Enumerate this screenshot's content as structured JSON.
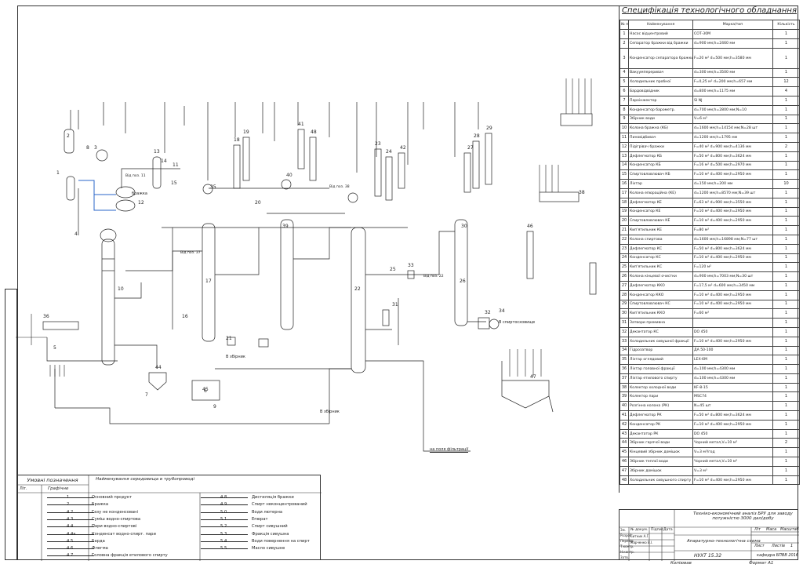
{
  "spec": {
    "title": "Специфікація технологічного обладнання",
    "headers": [
      "№ поз",
      "Найменування",
      "Марка/тип",
      "Кількість"
    ],
    "rows": [
      {
        "n": "1",
        "name": "Насос відцентровий",
        "mark": "СОТ-30М",
        "qty": "1"
      },
      {
        "n": "2",
        "name": "Сепаратор бражки від бражки",
        "mark": "d=900 мм;h=2460 мм",
        "qty": "1"
      },
      {
        "n": "3",
        "name": "Конденсатор сепаратора бражки бражки",
        "mark": "F=20 м² d=500 мм;h=3580 мм",
        "qty": "1"
      },
      {
        "n": "4",
        "name": "Вакуумпереривач",
        "mark": "d=300 мм;h=3500 мм",
        "qty": "1"
      },
      {
        "n": "5",
        "name": "Холодильник пробної",
        "mark": "F=0,25 м² d=200 мм;h=657 мм",
        "qty": "12"
      },
      {
        "n": "6",
        "name": "Бардовідвідник",
        "mark": "d=800 мм;h=1175 мм",
        "qty": "4"
      },
      {
        "n": "7",
        "name": "Пароінжектор",
        "mark": "SI NJ",
        "qty": "1"
      },
      {
        "n": "8",
        "name": "Конденсатор барометр.",
        "mark": "d=700 мм;h=2800 мм;N=10",
        "qty": "1"
      },
      {
        "n": "9",
        "name": "Збірник води",
        "mark": "V=6 м³",
        "qty": "1"
      },
      {
        "n": "10",
        "name": "Колона бражна (КБ)",
        "mark": "d=1600 мм;h=14154 мм;N=28 шт",
        "qty": "1"
      },
      {
        "n": "11",
        "name": "Пиновідбивач",
        "mark": "d=1200 мм;h=1795 мм",
        "qty": "1"
      },
      {
        "n": "12",
        "name": "Підігрівач бражки",
        "mark": "F=40 м² d=900 мм;h=4136 мм",
        "qty": "2"
      },
      {
        "n": "13",
        "name": "Дефлегматор КБ",
        "mark": "F=50 м² d=800 мм;h=3624 мм",
        "qty": "1"
      },
      {
        "n": "14",
        "name": "Конденсатор КБ",
        "mark": "F=16 м² d=500 мм;h=2970 мм",
        "qty": "1"
      },
      {
        "n": "15",
        "name": "Спиртовловлювач КБ",
        "mark": "F=10 м² d=400 мм;h=2950 мм",
        "qty": "1"
      },
      {
        "n": "16",
        "name": "Ліхтар",
        "mark": "d=150 мм;h=200 мм",
        "qty": "10"
      },
      {
        "n": "17",
        "name": "Колона епюраційна (КЕ)",
        "mark": "d=1200 мм;h=8570 мм;N=39 шт",
        "qty": "1"
      },
      {
        "n": "18",
        "name": "Дефлегматор КЕ",
        "mark": "F=63 м² d=900 мм;h=3550 мм",
        "qty": "1"
      },
      {
        "n": "19",
        "name": "Конденсатор КЕ",
        "mark": "F=10 м² d=400 мм;h=2950 мм",
        "qty": "1"
      },
      {
        "n": "20",
        "name": "Спиртовловлювач КЕ",
        "mark": "F=10 м² d=400 мм;h=2950 мм",
        "qty": "1"
      },
      {
        "n": "21",
        "name": "Кип'ятильник КЕ",
        "mark": "F=80 м²",
        "qty": "1"
      },
      {
        "n": "22",
        "name": "Колона спиртова",
        "mark": "d=1600 мм;h=16898 мм;N=77 шт",
        "qty": "1"
      },
      {
        "n": "23",
        "name": "Дефлегматор КС",
        "mark": "F=50 м² d=800 мм;h=3624 мм",
        "qty": "1"
      },
      {
        "n": "24",
        "name": "Конденсатор КС",
        "mark": "F=10 м² d=400 мм;h=2950 мм",
        "qty": "1"
      },
      {
        "n": "25",
        "name": "Кип'ятильник КС",
        "mark": "F=120 м²",
        "qty": "1"
      },
      {
        "n": "26",
        "name": "Колона кінцевої очистки",
        "mark": "d=900 мм;h=7003 мм;N=30 шт",
        "qty": "1"
      },
      {
        "n": "27",
        "name": "Дефлегматор ККО",
        "mark": "F=17,5 м² d=600 мм;h=3450 мм",
        "qty": "1"
      },
      {
        "n": "28",
        "name": "Конденсатор ККО",
        "mark": "F=10 м² d=400 мм;h=2950 мм",
        "qty": "1"
      },
      {
        "n": "29",
        "name": "Спиртовловлювач КС",
        "mark": "F=10 м² d=400 мм;h=2950 мм",
        "qty": "1"
      },
      {
        "n": "30",
        "name": "Кип'ятильник ККО",
        "mark": "F=60 м²",
        "qty": "1"
      },
      {
        "n": "31",
        "name": "Затвори промивна",
        "mark": "",
        "qty": "1"
      },
      {
        "n": "32",
        "name": "Декантатор КС",
        "mark": "DO 450",
        "qty": "1"
      },
      {
        "n": "33",
        "name": "Холодильник сивушної фракції",
        "mark": "F=10 м² d=400 мм;h=2950 мм",
        "qty": "1"
      },
      {
        "n": "34",
        "name": "Гідрозатвор",
        "mark": "ДА 50-100",
        "qty": "1"
      },
      {
        "n": "35",
        "name": "Ліхтар оглядовий",
        "mark": "LEX-6M",
        "qty": "1"
      },
      {
        "n": "36",
        "name": "Ліхтар головної фракції",
        "mark": "d=100 мм;h=4300 мм",
        "qty": "1"
      },
      {
        "n": "37",
        "name": "Ліхтар етилового спирту",
        "mark": "d=100 мм;h=4300 мм",
        "qty": "1"
      },
      {
        "n": "38",
        "name": "Колектор холодної води",
        "mark": "KF-8-15",
        "qty": "1"
      },
      {
        "n": "39",
        "name": "Колектор пари",
        "mark": "MSC74",
        "qty": "1"
      },
      {
        "n": "40",
        "name": "Розгінна колона (РК)",
        "mark": "N=45 шт",
        "qty": "1"
      },
      {
        "n": "41",
        "name": "Дефлегматор РК",
        "mark": "F=50 м² d=800 мм;h=3624 мм",
        "qty": "1"
      },
      {
        "n": "42",
        "name": "Конденсатор РК",
        "mark": "F=10 м² d=400 мм;h=2950 мм",
        "qty": "1"
      },
      {
        "n": "43",
        "name": "Декантатор РК",
        "mark": "DO 450",
        "qty": "1"
      },
      {
        "n": "44",
        "name": "Збірник гарячої води",
        "mark": "Чорний метал,V=10 м³",
        "qty": "2"
      },
      {
        "n": "45",
        "name": "Кінцевий збірник домішок",
        "mark": "V=3 м³/год",
        "qty": "1"
      },
      {
        "n": "46",
        "name": "Збірник теплої води",
        "mark": "Чорний метал,V=10 м³",
        "qty": "1"
      },
      {
        "n": "47",
        "name": "Збірник домішок",
        "mark": "V=3 м³",
        "qty": "1"
      },
      {
        "n": "48",
        "name": "Холодильник сивушного спирту",
        "mark": "F=10 м² d=400 мм;h=2950 мм",
        "qty": "1"
      }
    ]
  },
  "legend": {
    "title": "Умовні позначення",
    "col_lit": "Літ.",
    "col_graphic": "Графічне",
    "col_name": "Найменування середовища в трубопроводі",
    "left_items": [
      {
        "code": "1",
        "label": "Основний продукт"
      },
      {
        "code": "2",
        "label": "Бражка"
      },
      {
        "code": "4.2",
        "label": "Газу не конденсовані"
      },
      {
        "code": "4.3",
        "label": "Суміш водно-спиртова"
      },
      {
        "code": "4.4",
        "label": "Пари водно-спиртові"
      },
      {
        "code": "4.4а",
        "label": "Конденсат водно-спирт. пари"
      },
      {
        "code": "4.5",
        "label": "Барда"
      },
      {
        "code": "4.6",
        "label": "Флегма"
      },
      {
        "code": "4.7",
        "label": "Головна фракція етилового спирту"
      }
    ],
    "right_items": [
      {
        "code": "4.8",
        "label": "Дистиляція бражки"
      },
      {
        "code": "4.9",
        "label": "Спирт неконцентрований"
      },
      {
        "code": "5.0",
        "label": "Води лютерна"
      },
      {
        "code": "5.1",
        "label": "Епюрат"
      },
      {
        "code": "5.2",
        "label": "Спирт сивушний"
      },
      {
        "code": "5.3",
        "label": "Фракція сивушна"
      },
      {
        "code": "5.4",
        "label": "Води повернення на спирт"
      },
      {
        "code": "5.5",
        "label": "Масло сивушне"
      }
    ]
  },
  "titleblock": {
    "doc_title": "Техніко-економічний аналіз БРУ для заводу потужністю 3000 дал/добу",
    "sheet_name": "Апаратурно-технологічна схема",
    "code": "НУХТ 15.32",
    "dept": "кафедра БПВВ 2016",
    "lit_label": "Літ",
    "mass_label": "Маса",
    "scale_label": "Масштаб",
    "sheet_label": "Лист",
    "sheets_label": "Листів",
    "sheets_count": "1",
    "roles": [
      "Зм.",
      "Розроб.",
      "Перевір.",
      "Т.контр.",
      "Н.контр.",
      "Затв."
    ],
    "names": [
      "Ситник А.Г.",
      "Марченко В.І."
    ],
    "cols": [
      "Арк",
      "№ докум.",
      "Підпис",
      "Дата"
    ],
    "below_left": "Копіював",
    "below_right": "Формат А1"
  },
  "diagram": {
    "tags": {
      "to_pos11": "Від поз. 11",
      "to_pos37": "Від поз. 37",
      "brazhka": "бражка",
      "to_collector": "В збірник",
      "to_filter": "на поля фільтрації",
      "to_spirtosklad": "В спиртосховище",
      "in_col": "В збірник",
      "steam": "від пари",
      "water": "від холодної води",
      "from_pos38": "Від поз. 38",
      "from_pos22": "Від поз. 22",
      "from_pos47": "Від поз. 47",
      "from_pos31": "Від поз. 31"
    },
    "nums": [
      "1",
      "2",
      "3",
      "4",
      "5",
      "6",
      "7",
      "8",
      "9",
      "10",
      "11",
      "12",
      "13",
      "14",
      "15",
      "16",
      "17",
      "18",
      "19",
      "20",
      "21",
      "22",
      "23",
      "24",
      "25",
      "26",
      "27",
      "28",
      "29",
      "30",
      "31",
      "32",
      "33",
      "34",
      "35",
      "36",
      "38",
      "39",
      "40",
      "41",
      "42",
      "44",
      "45",
      "46",
      "47",
      "48"
    ]
  },
  "colors": {
    "ink": "#222222",
    "blue_line": "#2a64c8",
    "paper": "#ffffff"
  }
}
